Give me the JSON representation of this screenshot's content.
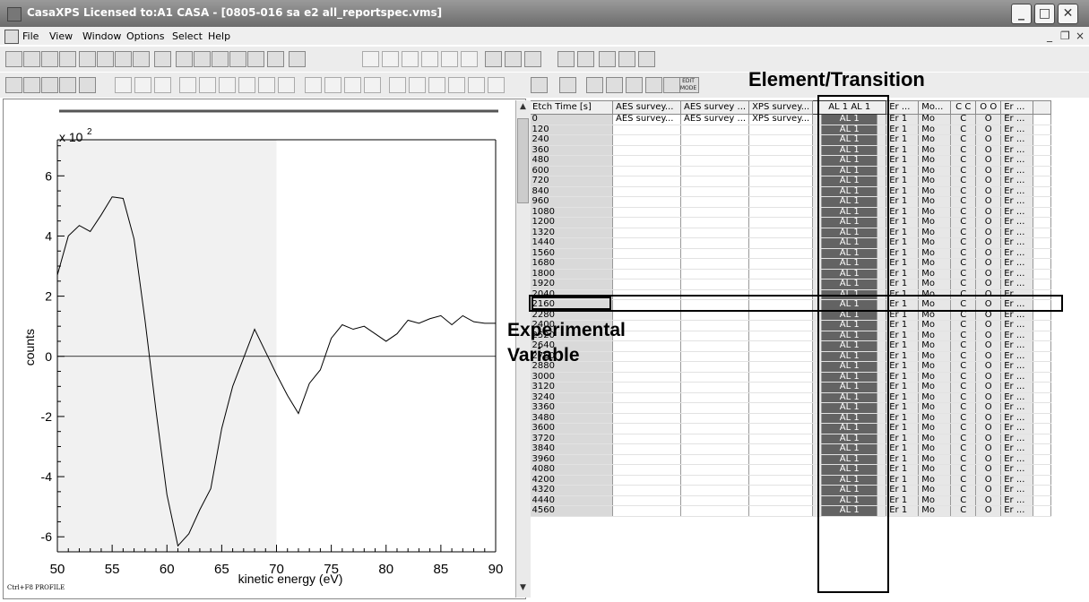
{
  "window": {
    "title": "CasaXPS Licensed to:A1 CASA - [0805-016 sa e2 all_reportspec.vms]"
  },
  "menu": {
    "items": [
      "File",
      "View",
      "Window",
      "Options",
      "Select",
      "Help"
    ]
  },
  "toolbar2": {
    "edit_mode_label": "EDIT MODE"
  },
  "chart_data": {
    "type": "line",
    "xlabel": "kinetic energy (eV)",
    "ylabel": "counts",
    "y_multiplier": "x 10",
    "y_multiplier_exp": "2",
    "xlim": [
      50,
      90
    ],
    "ylim": [
      -6.5,
      7.2
    ],
    "xticks": [
      50,
      55,
      60,
      65,
      70,
      75,
      80,
      85,
      90
    ],
    "yticks": [
      -6,
      -4,
      -2,
      0,
      2,
      4,
      6
    ],
    "shaded_region": [
      50,
      70
    ],
    "footer_text": "Ctrl+F8 PROFILE",
    "series": [
      {
        "x": [
          50,
          51,
          52,
          53,
          54,
          55,
          56,
          57,
          58,
          59,
          60,
          61,
          62,
          63,
          64,
          65,
          66,
          67,
          68,
          69,
          70,
          71,
          72,
          73,
          74,
          75,
          76,
          77,
          78,
          79,
          80,
          81,
          82,
          83,
          84,
          85,
          86,
          87,
          88,
          89,
          90
        ],
        "y": [
          2.7,
          4.0,
          4.35,
          4.15,
          4.7,
          5.3,
          5.25,
          3.9,
          1.2,
          -1.8,
          -4.6,
          -6.3,
          -5.9,
          -5.1,
          -4.4,
          -2.4,
          -1.0,
          -0.05,
          0.9,
          0.15,
          -0.6,
          -1.3,
          -1.9,
          -0.9,
          -0.45,
          0.6,
          1.05,
          0.9,
          1.0,
          0.75,
          0.5,
          0.75,
          1.2,
          1.1,
          1.25,
          1.35,
          1.05,
          1.35,
          1.15,
          1.1,
          1.1
        ]
      }
    ]
  },
  "grid": {
    "columns": [
      "Etch Time [s]",
      "AES survey...",
      "AES survey ...",
      "XPS survey...",
      "AL 1 AL 1",
      "Er ...",
      "Mo...",
      "C C",
      "O O",
      "Er ..."
    ],
    "row0": {
      "etch": "0",
      "aes1": "AES survey...",
      "aes2": "AES survey ...",
      "xps": "XPS survey..."
    },
    "etch_times": [
      "0",
      "120",
      "240",
      "360",
      "480",
      "600",
      "720",
      "840",
      "960",
      "1080",
      "1200",
      "1320",
      "1440",
      "1560",
      "1680",
      "1800",
      "1920",
      "2040",
      "2160",
      "2280",
      "2400",
      "2520",
      "2640",
      "2760",
      "2880",
      "3000",
      "3120",
      "3240",
      "3360",
      "3480",
      "3600",
      "3720",
      "3840",
      "3960",
      "4080",
      "4200",
      "4320",
      "4440",
      "4560"
    ],
    "cell_values": {
      "al": "AL 1",
      "er": "Er 1",
      "mo": "Mo",
      "c": "C",
      "o": "O",
      "er2": "Er ..."
    }
  },
  "annotations": {
    "element_transition": "Element/Transition",
    "experimental_variable_line1": "Experimental",
    "experimental_variable_line2": "Variable"
  }
}
